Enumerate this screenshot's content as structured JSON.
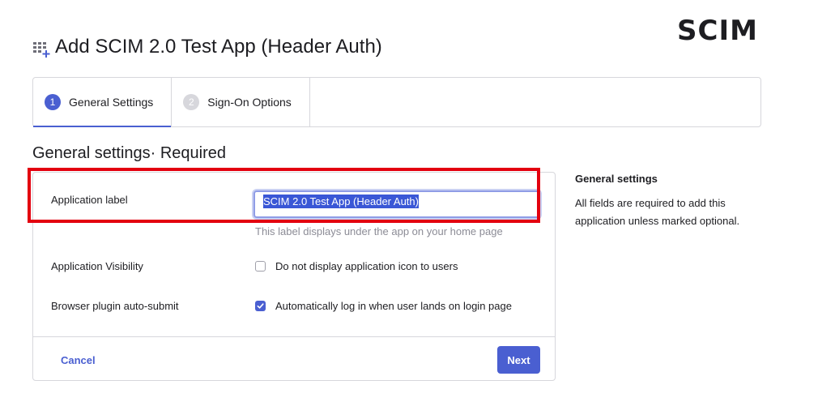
{
  "logo": {
    "text": "SCIM"
  },
  "header": {
    "title": "Add SCIM 2.0 Test App (Header Auth)",
    "icon": "grid-plus-icon"
  },
  "tabs": [
    {
      "number": "1",
      "label": "General Settings",
      "active": true
    },
    {
      "number": "2",
      "label": "Sign-On Options",
      "active": false
    }
  ],
  "section": {
    "heading": "General settings· Required"
  },
  "form": {
    "app_label": {
      "label": "Application label",
      "value": "SCIM 2.0 Test App (Header Auth)",
      "hint": "This label displays under the app on your home page"
    },
    "visibility": {
      "label": "Application Visibility",
      "option": "Do not display application icon to users",
      "checked": false
    },
    "auto_submit": {
      "label": "Browser plugin auto-submit",
      "option": "Automatically log in when user lands on login page",
      "checked": true
    },
    "cancel_label": "Cancel",
    "next_label": "Next"
  },
  "aside": {
    "title": "General settings",
    "body": "All fields are required to add this application unless marked optional."
  },
  "colors": {
    "accent": "#4a5fd1",
    "highlight": "#e3000f"
  }
}
